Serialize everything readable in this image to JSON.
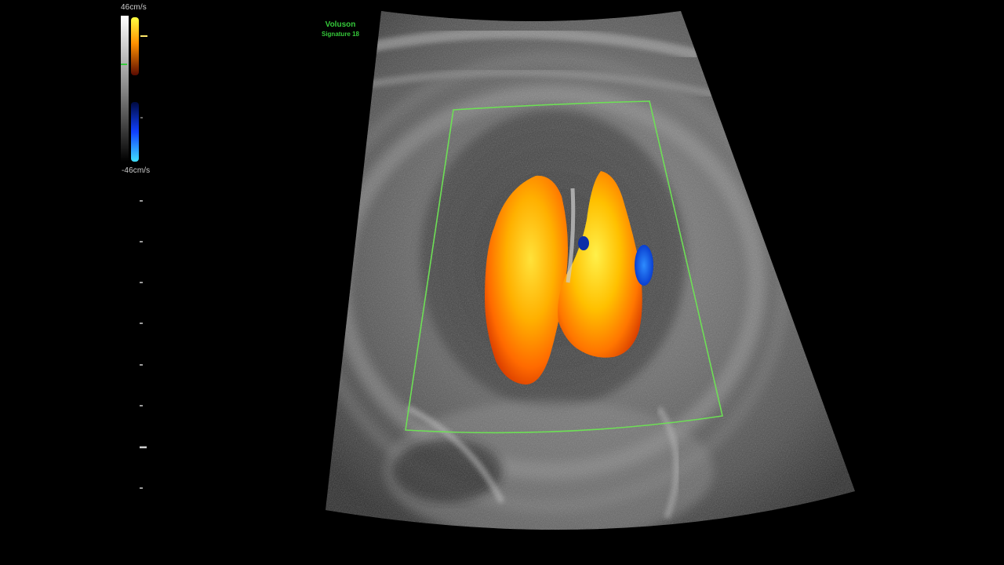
{
  "overlay": {
    "velocity_scale": {
      "max_label": "46cm/s",
      "min_label": "-46cm/s"
    },
    "brand": {
      "name": "Voluson",
      "model": "Signature 18"
    }
  },
  "colors": {
    "background": "#000000",
    "roi_box": "#6ddf55",
    "brand_text": "#35c93a",
    "flow_toward": "#ff9a00",
    "flow_away": "#1560ff"
  },
  "icons": {
    "velocity_colorbar": "doppler-color-scale-icon",
    "depth_ruler": "depth-scale-icon"
  }
}
